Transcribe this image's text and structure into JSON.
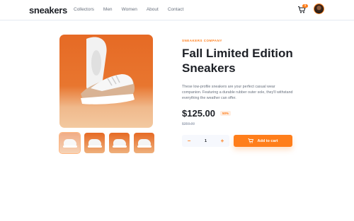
{
  "header": {
    "logo": "sneakers",
    "nav": [
      "Collectors",
      "Men",
      "Women",
      "About",
      "Contact"
    ],
    "cart_count": "3"
  },
  "product": {
    "company": "SNEAKERS COMPANY",
    "title": "Fall Limited Edition Sneakers",
    "description": "These low-profile sneakers are your perfect casual wear companion. Featuring a durable rubber outer sole, they'll withstand everything the weather can offer.",
    "price": "$125.00",
    "discount": "50%",
    "old_price": "$250.00",
    "quantity": "1",
    "decrement": "−",
    "increment": "+",
    "add_to_cart": "Add to cart"
  },
  "colors": {
    "accent": "#ff7e1b",
    "text_dark": "#1d2026",
    "text_muted": "#68707d"
  }
}
